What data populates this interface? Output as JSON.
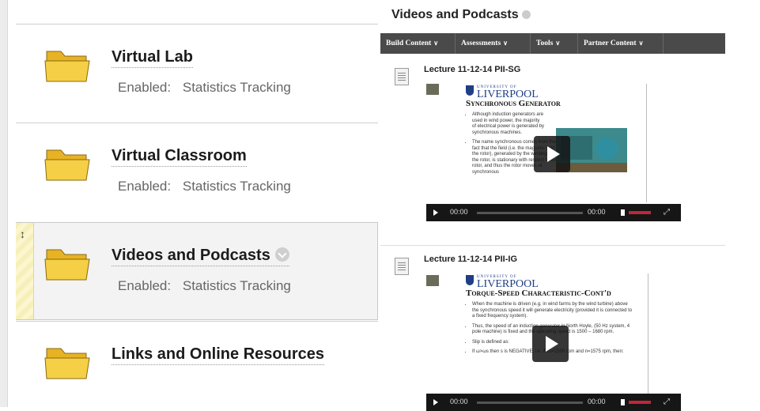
{
  "course_menu": {
    "items": [
      {
        "title": "Virtual Lab",
        "status_label": "Enabled:",
        "status_value": "Statistics Tracking"
      },
      {
        "title": "Virtual Classroom",
        "status_label": "Enabled:",
        "status_value": "Statistics Tracking"
      },
      {
        "title": "Videos and Podcasts",
        "status_label": "Enabled:",
        "status_value": "Statistics Tracking"
      },
      {
        "title": "Links and Online Resources"
      }
    ]
  },
  "content_area": {
    "title": "Videos and Podcasts",
    "toolbar": [
      "Build Content",
      "Assessments",
      "Tools",
      "Partner Content"
    ],
    "lectures": [
      {
        "title": "Lecture 11-12-14 PII-SG",
        "slide": {
          "university_top": "UNIVERSITY OF",
          "university_name": "LIVERPOOL",
          "heading": "Synchronous Generator",
          "bullets": [
            "Although induction generators are used in wind power, the majority of electrical power is generated by synchronous machines.",
            "The name synchronous comes from the fact that the field (i.e. the magnetic field of the rotor), generated by the winding on the rotor, is stationary with respect to the rotor, and thus the rotor moves at synchronous"
          ]
        },
        "player": {
          "current": "00:00",
          "duration": "00:00"
        }
      },
      {
        "title": "Lecture 11-12-14 PII-IG",
        "slide": {
          "university_top": "UNIVERSITY OF",
          "university_name": "LIVERPOOL",
          "heading": "Torque-Speed Characteristic-Cont'd",
          "bullets": [
            "When the machine is driven (e.g. in wind farms by the wind turbine) above the synchronous speed it will generate electricity (provided it is connected to a fixed frequency system).",
            "Thus, the speed of an induction generator in North Hoyle, (50 Hz system, 4 pole machine) is fixed and the operating speed is 1500 – 1680 rpm.",
            "Slip is defined as:",
            "If ω>ωs then s is NEGATIVE, i.e. if ns=1500 rpm and n=1575 rpm, then:"
          ]
        },
        "player": {
          "current": "00:00",
          "duration": "00:00"
        }
      }
    ]
  }
}
